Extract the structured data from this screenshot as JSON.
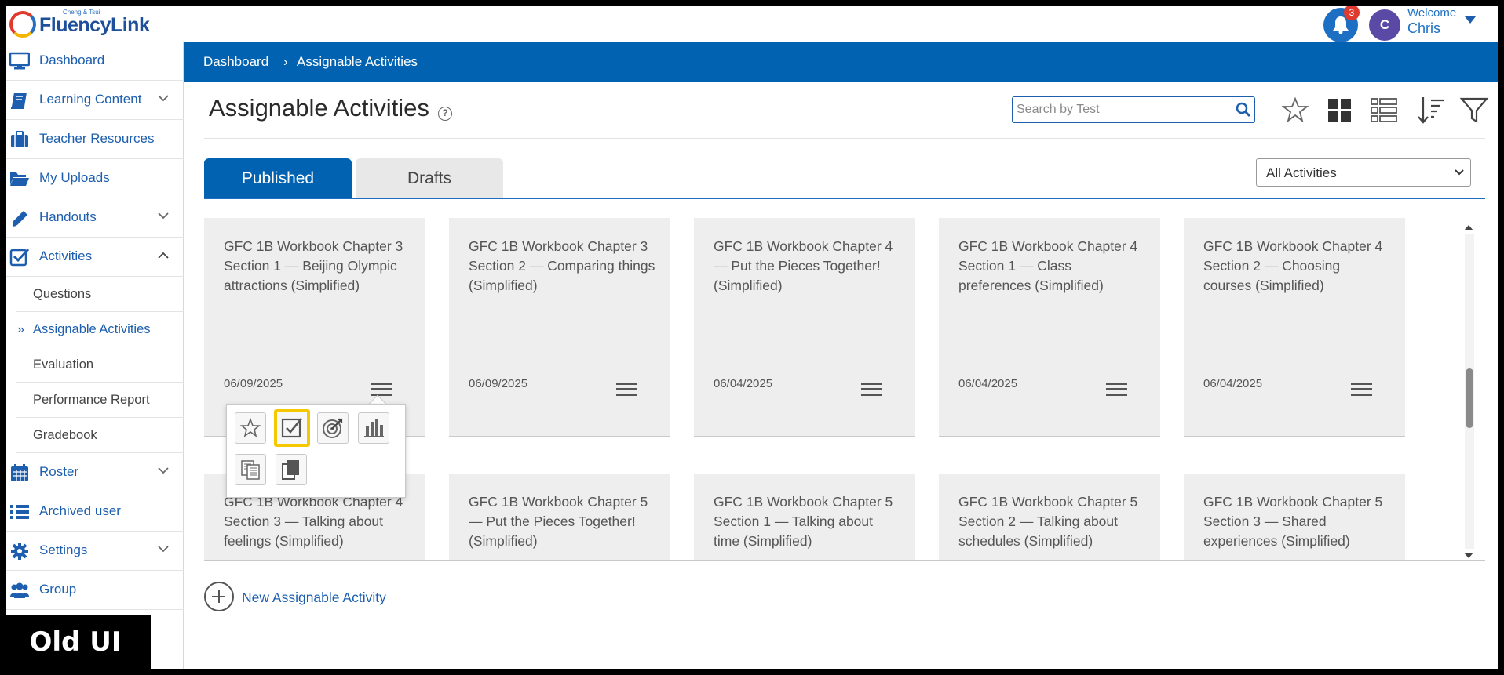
{
  "header": {
    "logo_small": "Cheng & Tsui",
    "logo_text": "FluencyLink",
    "notification_count": "3",
    "avatar_initial": "C",
    "welcome": "Welcome",
    "user_name": "Chris"
  },
  "sidebar": {
    "items": [
      {
        "label": "Dashboard"
      },
      {
        "label": "Learning Content"
      },
      {
        "label": "Teacher Resources"
      },
      {
        "label": "My Uploads"
      },
      {
        "label": "Handouts"
      },
      {
        "label": "Activities"
      },
      {
        "label": "Roster"
      },
      {
        "label": "Archived user"
      },
      {
        "label": "Settings"
      },
      {
        "label": "Group"
      }
    ],
    "sub_items": [
      {
        "label": "Questions"
      },
      {
        "label": "Assignable Activities"
      },
      {
        "label": "Evaluation"
      },
      {
        "label": "Performance Report"
      },
      {
        "label": "Gradebook"
      }
    ],
    "active_marker": "»"
  },
  "breadcrumb": {
    "home": "Dashboard",
    "separator": "›",
    "current": "Assignable Activities"
  },
  "page": {
    "title": "Assignable Activities",
    "help": "?"
  },
  "search": {
    "placeholder": "Search by Test",
    "value": ""
  },
  "tabs": {
    "published": "Published",
    "drafts": "Drafts"
  },
  "filter": {
    "selected": "All Activities"
  },
  "cards": [
    {
      "title": "GFC 1B Workbook Chapter 3 Section 1 — Beijing Olympic attractions (Simplified)",
      "date": "06/09/2025"
    },
    {
      "title": "GFC 1B Workbook Chapter 3 Section 2 — Comparing things (Simplified)",
      "date": "06/09/2025"
    },
    {
      "title": "GFC 1B Workbook Chapter 4 — Put the Pieces Together! (Simplified)",
      "date": "06/04/2025"
    },
    {
      "title": "GFC 1B Workbook Chapter 4 Section 1 — Class preferences (Simplified)",
      "date": "06/04/2025"
    },
    {
      "title": "GFC 1B Workbook Chapter 4 Section 2 — Choosing courses (Simplified)",
      "date": "06/04/2025"
    },
    {
      "title": "GFC 1B Workbook Chapter 4 Section 3 — Talking about feelings (Simplified)",
      "date": ""
    },
    {
      "title": "GFC 1B Workbook Chapter 5 — Put the Pieces Together! (Simplified)",
      "date": ""
    },
    {
      "title": "GFC 1B Workbook Chapter 5 Section 1 — Talking about time (Simplified)",
      "date": ""
    },
    {
      "title": "GFC 1B Workbook Chapter 5 Section 2 — Talking about schedules (Simplified)",
      "date": ""
    },
    {
      "title": "GFC 1B Workbook Chapter 5 Section 3 — Shared experiences (Simplified)",
      "date": ""
    }
  ],
  "popup": {
    "buttons": [
      "star-icon",
      "assign-check-icon",
      "target-icon",
      "bar-chart-icon",
      "document-copy-icon",
      "duplicate-icon"
    ]
  },
  "new_activity": {
    "label": "New Assignable Activity"
  },
  "overlay": {
    "label": "Old UI"
  }
}
